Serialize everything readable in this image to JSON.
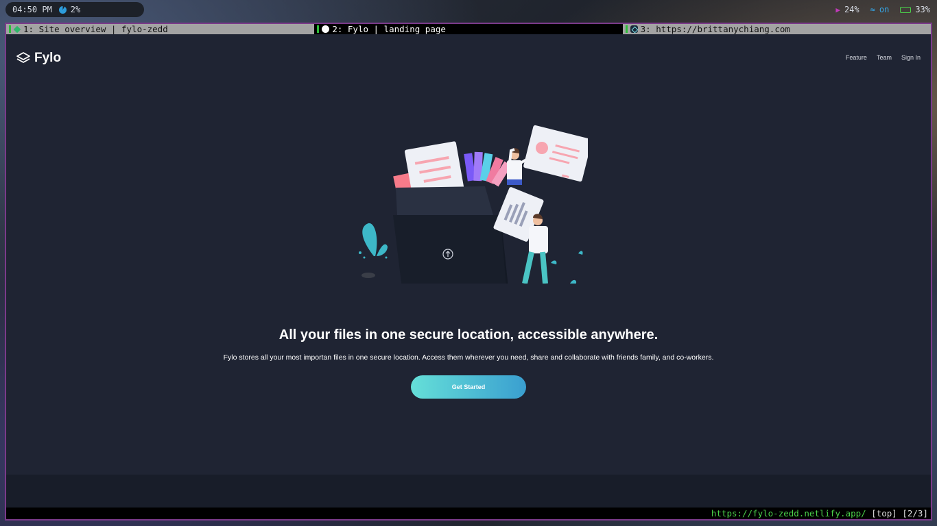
{
  "system_bar": {
    "time": "04:50 PM",
    "cpu": "2%",
    "volume": "24%",
    "wifi_state": "on",
    "battery": "33%"
  },
  "tabs": [
    {
      "label": "1: Site overview | fylo-zedd",
      "active": false
    },
    {
      "label": "2: Fylo | landing page",
      "active": true
    },
    {
      "label": "3: https://brittanychiang.com",
      "active": false
    }
  ],
  "nav": {
    "brand": "Fylo",
    "links": [
      "Feature",
      "Team",
      "Sign In"
    ]
  },
  "hero": {
    "title": "All your files in one secure location, accessible anywhere.",
    "subtitle": "Fylo stores all your most importan files in one secure location. Access them wherever you need, share and collaborate with friends family, and co-workers.",
    "cta": "Get Started"
  },
  "statusline": {
    "url": "https://fylo-zedd.netlify.app/",
    "scroll": "[top]",
    "tab_index": "[2/3]"
  },
  "colors": {
    "page_bg": "#1f2433",
    "footer_bg": "#181d29",
    "cta_start": "#65dfd8",
    "cta_end": "#3a9fd0",
    "window_border": "#7b3a8a",
    "tab_active_bg": "#000000",
    "tab_inactive_bg": "#a3a3a3",
    "url_green": "#4bd24b"
  }
}
